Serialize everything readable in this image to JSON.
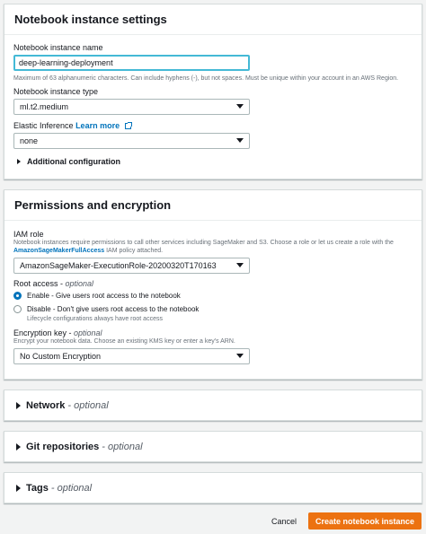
{
  "settings": {
    "title": "Notebook instance settings",
    "name_label": "Notebook instance name",
    "name_value": "deep-learning-deployment",
    "name_help": "Maximum of 63 alphanumeric characters. Can include hyphens (-), but not spaces. Must be unique within your account in an AWS Region.",
    "type_label": "Notebook instance type",
    "type_value": "ml.t2.medium",
    "ei_label": "Elastic Inference",
    "ei_link": "Learn more",
    "ei_value": "none",
    "additional": "Additional configuration"
  },
  "permissions": {
    "title": "Permissions and encryption",
    "iam_label": "IAM role",
    "iam_help_1": "Notebook instances require permissions to call other services including SageMaker and S3. Choose a role or let us create a role with the",
    "iam_help_policy": "AmazonSageMakerFullAccess",
    "iam_help_2": " IAM policy attached.",
    "iam_value": "AmazonSageMaker-ExecutionRole-20200320T170163",
    "root_label": "Root access - ",
    "root_optional": "optional",
    "enable_label": "Enable - Give users root access to the notebook",
    "disable_label": "Disable - Don't give users root access to the notebook",
    "disable_help": "Lifecycle configurations always have root access",
    "enc_label": "Encryption key - ",
    "enc_optional": "optional",
    "enc_help": "Encrypt your notebook data. Choose an existing KMS key or enter a key's ARN.",
    "enc_value": "No Custom Encryption"
  },
  "sections": {
    "network": "Network",
    "git": "Git repositories",
    "tags": "Tags",
    "optional": "- optional"
  },
  "footer": {
    "cancel": "Cancel",
    "create": "Create notebook instance"
  }
}
